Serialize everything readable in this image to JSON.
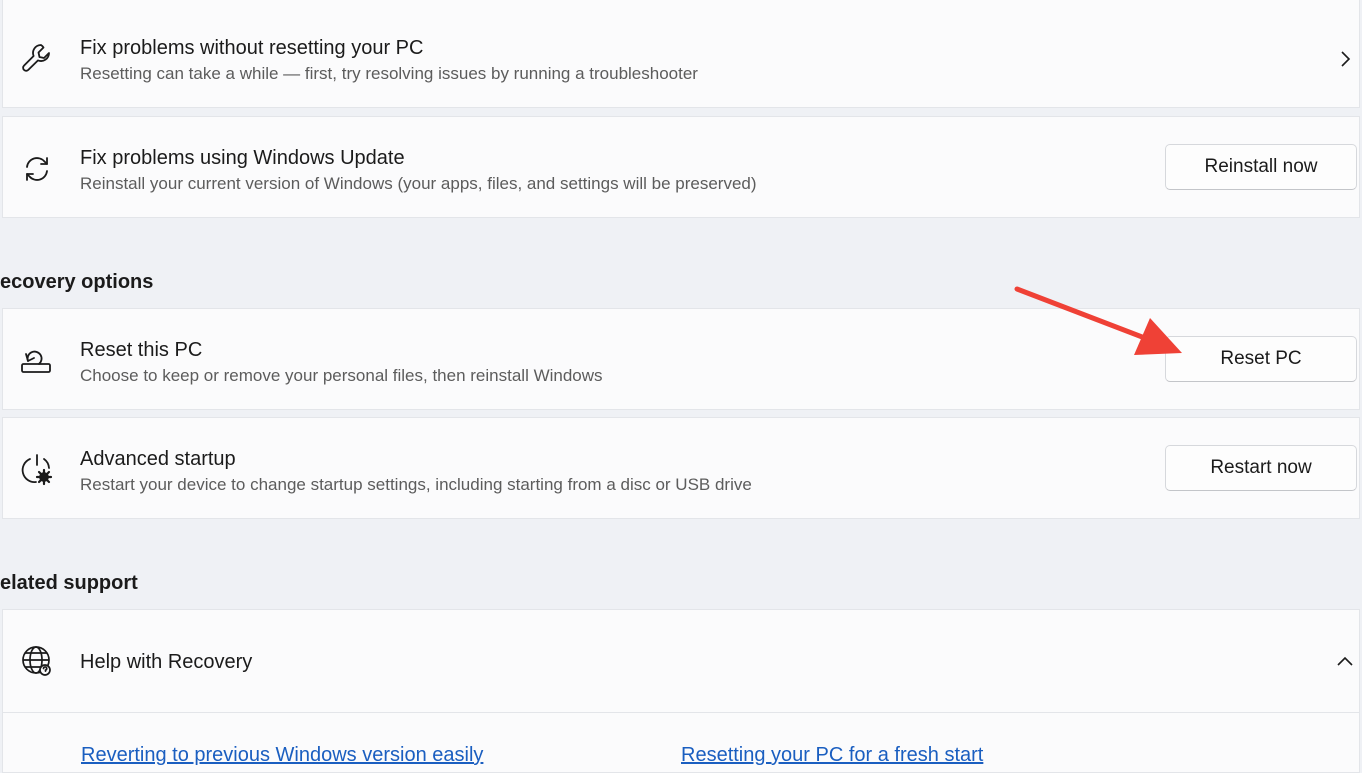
{
  "cards": {
    "fix_without_reset": {
      "title": "Fix problems without resetting your PC",
      "desc": "Resetting can take a while — first, try resolving issues by running a troubleshooter",
      "icon": "wrench-icon"
    },
    "fix_windows_update": {
      "title": "Fix problems using Windows Update",
      "desc": "Reinstall your current version of Windows (your apps, files, and settings will be preserved)",
      "button": "Reinstall now",
      "icon": "sync-icon"
    },
    "reset_pc": {
      "title": "Reset this PC",
      "desc": "Choose to keep or remove your personal files, then reinstall Windows",
      "button": "Reset PC",
      "icon": "reset-pc-icon"
    },
    "advanced_startup": {
      "title": "Advanced startup",
      "desc": "Restart your device to change startup settings, including starting from a disc or USB drive",
      "button": "Restart now",
      "icon": "startup-gear-icon"
    },
    "help_recovery": {
      "title": "Help with Recovery",
      "icon": "globe-help-icon"
    }
  },
  "sections": {
    "recovery_options": "ecovery options",
    "related_support": "elated support"
  },
  "links": {
    "reverting": "Reverting to previous Windows version easily",
    "resetting": "Resetting your PC for a fresh start"
  },
  "colors": {
    "annotation_arrow": "#ef4136",
    "link": "#1a5ec0"
  }
}
